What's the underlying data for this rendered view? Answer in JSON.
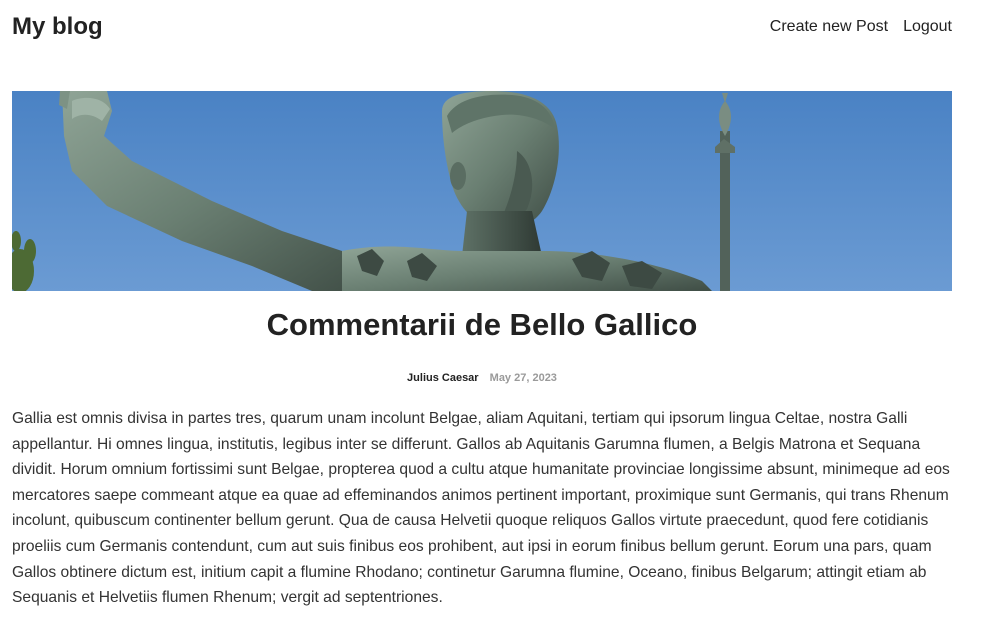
{
  "header": {
    "site_title": "My blog",
    "nav": {
      "create_post": "Create new Post",
      "logout": "Logout"
    }
  },
  "post": {
    "title": "Commentarii de Bello Gallico",
    "author": "Julius Caesar",
    "date": "May 27, 2023",
    "body": "Gallia est omnis divisa in partes tres, quarum unam incolunt Belgae, aliam Aquitani, tertiam qui ipsorum lingua Celtae, nostra Galli appellantur. Hi omnes lingua, institutis, legibus inter se differunt. Gallos ab Aquitanis Garumna flumen, a Belgis Matrona et Sequana dividit. Horum omnium fortissimi sunt Belgae, propterea quod a cultu atque humanitate provinciae longissime absunt, minimeque ad eos mercatores saepe commeant atque ea quae ad effeminandos animos pertinent important, proximique sunt Germanis, qui trans Rhenum incolunt, quibuscum continenter bellum gerunt. Qua de causa Helvetii quoque reliquos Gallos virtute praecedunt, quod fere cotidianis proeliis cum Germanis contendunt, cum aut suis finibus eos prohibent, aut ipsi in eorum finibus bellum gerunt. Eorum una pars, quam Gallos obtinere dictum est, initium capit a flumine Rhodano; continetur Garumna flumine, Oceano, finibus Belgarum; attingit etiam ab Sequanis et Helvetiis flumen Rhenum; vergit ad septentriones."
  },
  "colors": {
    "sky": "#4f86c6",
    "statue": "#6f8478",
    "text": "#222222",
    "date": "#9a9a9a"
  }
}
